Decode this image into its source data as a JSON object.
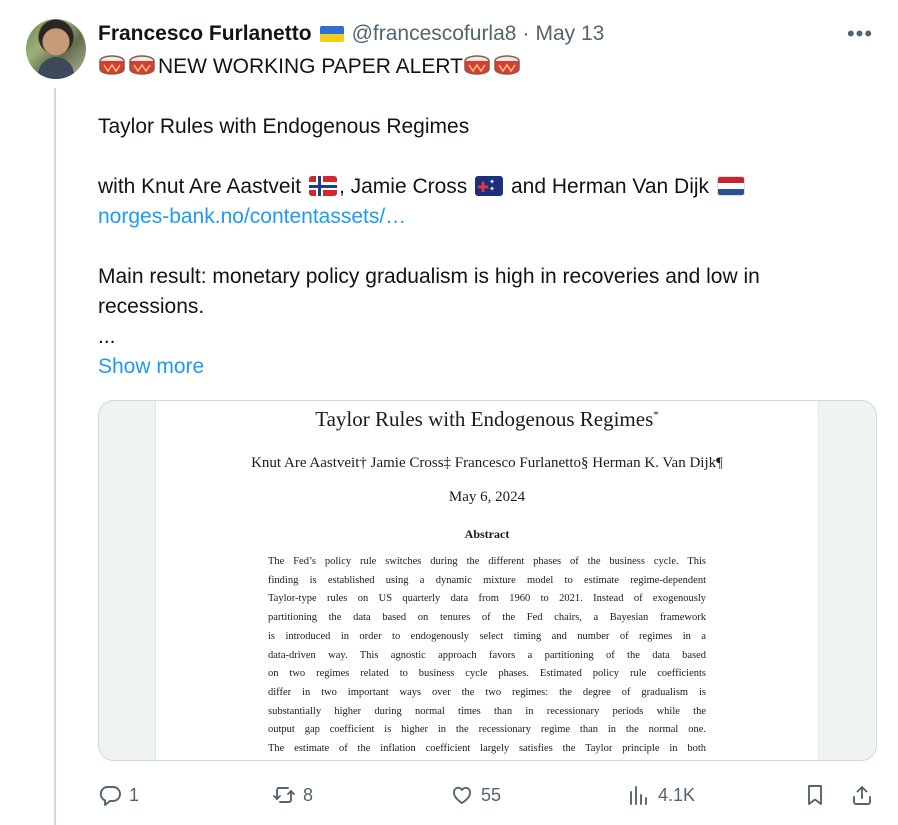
{
  "author": {
    "name": "Francesco Furlanetto",
    "handle": "@francescofurla8",
    "separator": "·",
    "date": "May 13"
  },
  "tweet": {
    "headline": "NEW WORKING PAPER ALERT",
    "paper_title": "Taylor Rules with Endogenous Regimes",
    "coauthors_prefix": "with Knut Are Aastveit",
    "coauthor_2": ", Jamie Cross",
    "coauthor_3": " and Herman Van Dijk",
    "link": "norges-bank.no/contentassets/…",
    "main_result": "Main result: monetary policy gradualism is high in recoveries and low in recessions.",
    "ellipsis": "...",
    "show_more": "Show more"
  },
  "paper_image": {
    "title": "Taylor Rules with Endogenous Regimes",
    "title_mark": "*",
    "authors": "Knut Are Aastveit† Jamie Cross‡ Francesco Furlanetto§ Herman K. Van Dijk¶",
    "date": "May 6, 2024",
    "abstract_heading": "Abstract",
    "abstract_lines": [
      "The Fed’s policy rule switches during the different phases of the business cycle. This",
      "finding is established using a dynamic mixture model to estimate regime-dependent",
      "Taylor-type rules on US quarterly data from 1960 to 2021. Instead of exogenously",
      "partitioning the data based on tenures of the Fed chairs, a Bayesian framework",
      "is introduced in order to endogenously select timing and number of regimes in a",
      "data-driven way. This agnostic approach favors a partitioning of the data based",
      "on two regimes related to business cycle phases. Estimated policy rule coefficients",
      "differ in two important ways over the two regimes: the degree of gradualism is",
      "substantially higher during normal times than in recessionary periods while the",
      "output gap coefficient is higher in the recessionary regime than in the normal one.",
      "The estimate of the inflation coefficient largely satisfies the Taylor principle in both"
    ]
  },
  "actions": {
    "replies": "1",
    "reposts": "8",
    "likes": "55",
    "views": "4.1K"
  },
  "icons": [
    "more-icon",
    "reply-icon",
    "repost-icon",
    "like-icon",
    "views-icon",
    "bookmark-icon",
    "share-icon"
  ],
  "colors": {
    "link": "#1d9bf0",
    "muted": "#536471",
    "text": "#0f1419",
    "border": "#cfd9de"
  }
}
